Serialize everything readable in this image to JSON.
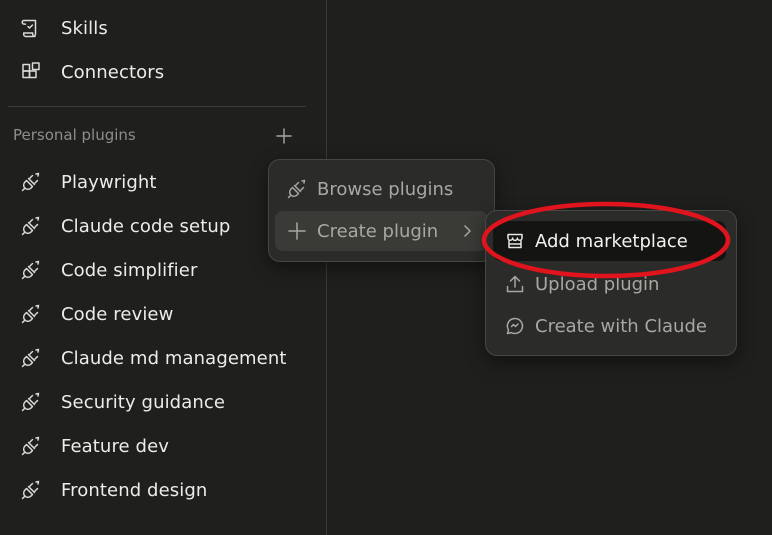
{
  "sidebar": {
    "top_items": [
      {
        "label": "Skills",
        "icon": "skills-scroll-icon"
      },
      {
        "label": "Connectors",
        "icon": "connectors-blocks-icon"
      }
    ],
    "section": {
      "title": "Personal plugins",
      "add_icon": "plus-icon"
    },
    "plugins": [
      {
        "label": "Playwright"
      },
      {
        "label": "Claude code setup"
      },
      {
        "label": "Code simplifier"
      },
      {
        "label": "Code review"
      },
      {
        "label": "Claude md management"
      },
      {
        "label": "Security guidance"
      },
      {
        "label": "Feature dev"
      },
      {
        "label": "Frontend design"
      }
    ]
  },
  "menu": {
    "items": [
      {
        "label": "Browse plugins",
        "icon": "plug-icon"
      },
      {
        "label": "Create plugin",
        "icon": "plus-icon",
        "submenu_icon": "chevron-right-icon"
      }
    ]
  },
  "submenu": {
    "items": [
      {
        "label": "Add marketplace",
        "icon": "store-icon"
      },
      {
        "label": "Upload plugin",
        "icon": "upload-icon"
      },
      {
        "label": "Create with Claude",
        "icon": "chat-bubble-icon"
      }
    ]
  },
  "colors": {
    "background": "#1f1f1e",
    "menu_background": "#2b2b29",
    "highlight_background": "#141413",
    "annotation_red": "#e0141c",
    "text_primary": "#ececea",
    "text_muted": "#8f8d88"
  }
}
